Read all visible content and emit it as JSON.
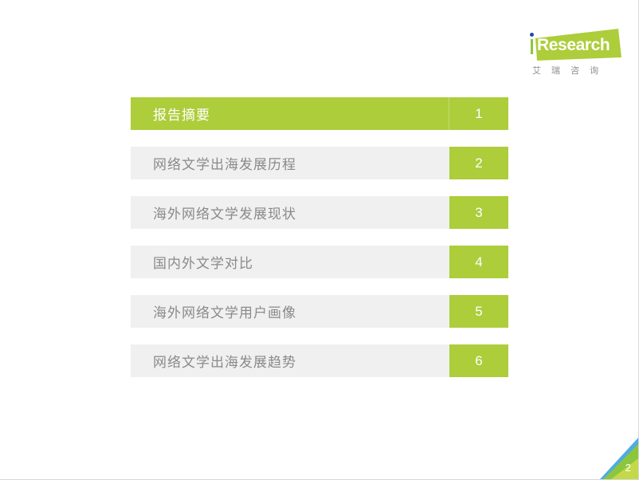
{
  "brand": {
    "logo_name": "iResearch",
    "logo_word": "Research",
    "logo_initial": "i",
    "logo_subtitle": "艾 瑞 咨 询",
    "green": "#adcd3b",
    "logo_green": "#8cc63e",
    "dot_blue": "#1d4f9e"
  },
  "toc": {
    "items": [
      {
        "label": "报告摘要",
        "number": "1",
        "active": true
      },
      {
        "label": "网络文学出海发展历程",
        "number": "2",
        "active": false
      },
      {
        "label": "海外网络文学发展现状",
        "number": "3",
        "active": false
      },
      {
        "label": "国内外文学对比",
        "number": "4",
        "active": false
      },
      {
        "label": "海外网络文学用户画像",
        "number": "5",
        "active": false
      },
      {
        "label": "网络文学出海发展趋势",
        "number": "6",
        "active": false
      }
    ]
  },
  "footer": {
    "page_number": "2",
    "corner_blue": "#4eacdf",
    "corner_green": "#8cc63e",
    "corner_light_green": "#c3d94a"
  }
}
